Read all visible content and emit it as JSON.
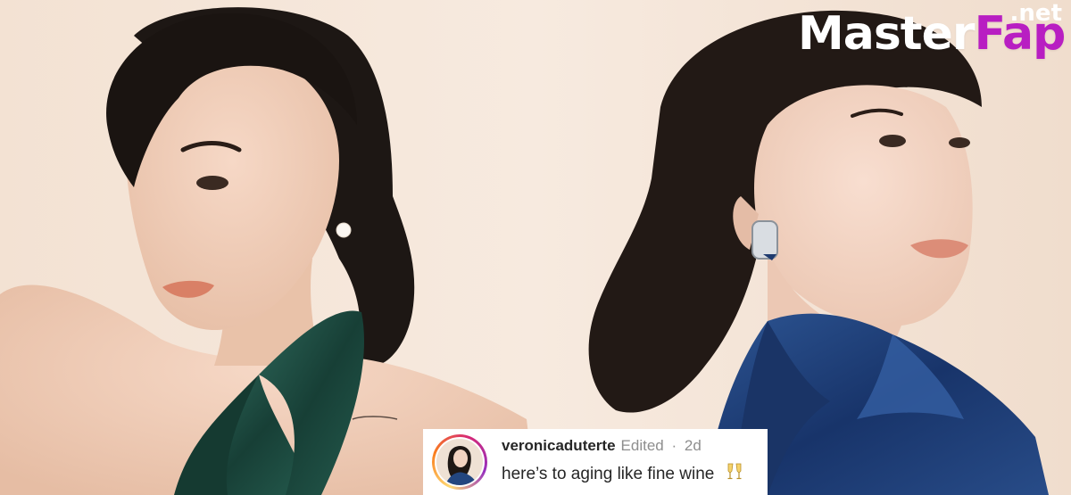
{
  "watermark": {
    "part1": "Master",
    "part2": "Fap",
    "suffix": ".net",
    "accent_color": "#b81ec2"
  },
  "post": {
    "username": "veronicaduterte",
    "edited_label": "Edited",
    "separator": "·",
    "age": "2d",
    "caption": "here’s to aging like fine wine",
    "emoji_icon": "clinking-glasses-icon",
    "ring_colors": [
      "#feda75",
      "#fa7e1e",
      "#d62976",
      "#962fbf"
    ]
  },
  "scene": {
    "background": "#f4e4d5",
    "left_outfit_color": "#1f4f45",
    "right_outfit_color": "#1f3f75",
    "hair_color": "#1c1613"
  }
}
